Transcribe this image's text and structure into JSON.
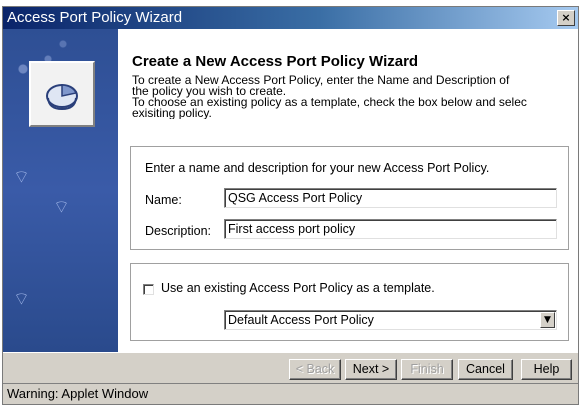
{
  "window": {
    "title": "Access Port Policy Wizard",
    "close_glyph": "×"
  },
  "side_panel": {
    "icon": "policy-disk-icon",
    "background_color": "#2e4f94"
  },
  "header": {
    "heading": "Create a New Access Port Policy Wizard",
    "intro_lines": [
      "To create a New Access Port Policy, enter the Name and Description of",
      "the policy you wish to create.",
      "To choose an existing policy as a template, check the box below and selec",
      "exisiting policy."
    ]
  },
  "details_group": {
    "instruction": "Enter a name and description for your new Access Port Policy.",
    "name_label": "Name:",
    "name_value": "QSG Access Port Policy",
    "description_label": "Description:",
    "description_value": "First access port policy"
  },
  "template_group": {
    "checkbox_label": "Use an existing Access Port Policy as a template.",
    "checked": false,
    "selected_template": "Default Access Port Policy"
  },
  "buttons": {
    "back": "< Back",
    "next": "Next >",
    "finish": "Finish",
    "cancel": "Cancel",
    "help": "Help"
  },
  "status": {
    "text": "Warning: Applet Window"
  },
  "colors": {
    "title_bar": "#0a246a",
    "dialog_face": "#d4d0c8",
    "side_panel": "#2e4f94"
  }
}
